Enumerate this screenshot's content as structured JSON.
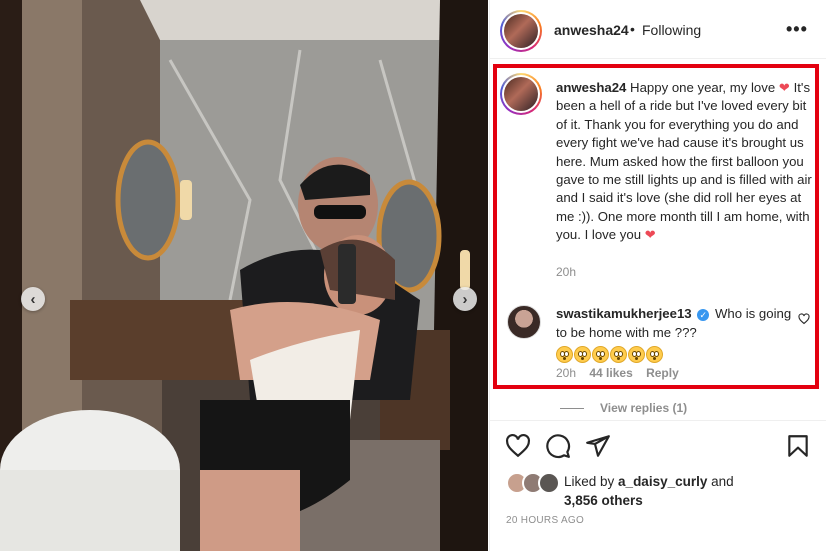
{
  "post": {
    "username": "anwesha24",
    "separator": "•",
    "follow_status": "Following",
    "more_icon": "more-options-icon",
    "caption_text": "Happy one year, my love",
    "caption_body": "It's been a hell of a ride but I've loved every bit of it. Thank you for everything you do and every fight we've had cause it's brought us here. Mum asked how the first balloon you gave to me still lights up and is filled with air and I said it's love (she did roll her eyes at me :)). One more month till I am home, with you. I love you",
    "caption_time": "20h"
  },
  "comment": {
    "username": "swastikamukherjee13",
    "verified": true,
    "text": "Who is going to be home with me ???",
    "emoji_count": 6,
    "emoji_name": "flushed-face",
    "time": "20h",
    "likes": "44 likes",
    "reply_label": "Reply"
  },
  "view_replies": "View replies (1)",
  "likes": {
    "prefix": "Liked by ",
    "user": "a_daisy_curly",
    "and": " and",
    "others": "3,856 others"
  },
  "timestamp": "20 HOURS AGO",
  "colors": {
    "highlight_border": "#e3000f",
    "heart": "#ed4956",
    "verified": "#3897f0",
    "muted_text": "#8e8e8e"
  },
  "carousel": {
    "prev_icon": "chevron-left-icon",
    "next_icon": "chevron-right-icon",
    "prev_glyph": "‹",
    "next_glyph": "›"
  }
}
